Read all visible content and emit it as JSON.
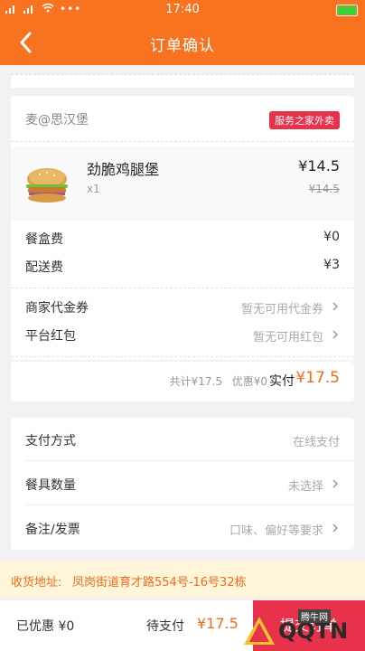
{
  "status_bar": {
    "time": "17:40"
  },
  "nav": {
    "title": "订单确认"
  },
  "shop": {
    "name": "麦@思汉堡",
    "tag": "服务之家外卖"
  },
  "item": {
    "name": "劲脆鸡腿堡",
    "qty": "x1",
    "price": "¥14.5",
    "original_price": "¥14.5"
  },
  "fees": [
    {
      "label": "餐盒费",
      "value": "¥0"
    },
    {
      "label": "配送费",
      "value": "¥3"
    }
  ],
  "coupons": [
    {
      "label": "商家代金券",
      "value": "暂无可用代金券"
    },
    {
      "label": "平台红包",
      "value": "暂无可用红包"
    }
  ],
  "totals": {
    "total": "共计¥17.5",
    "discount": "优惠¥0",
    "paid_label": "实付",
    "paid_value": "¥17.5"
  },
  "payment": {
    "method_label": "支付方式",
    "method_value": "在线支付",
    "utensils_label": "餐具数量",
    "utensils_value": "未选择",
    "notes_label": "备注/发票",
    "notes_value": "口味、偏好等要求"
  },
  "address": {
    "label": "收货地址:",
    "value": "凤岗街道育才路554号-16号32栋"
  },
  "bottom": {
    "saved": "已优惠 ¥0",
    "to_pay_label": "待支付",
    "to_pay_value": "¥17.5",
    "submit": "提交订单"
  },
  "watermark": {
    "text": "QQTN",
    "small": "腾牛网"
  }
}
